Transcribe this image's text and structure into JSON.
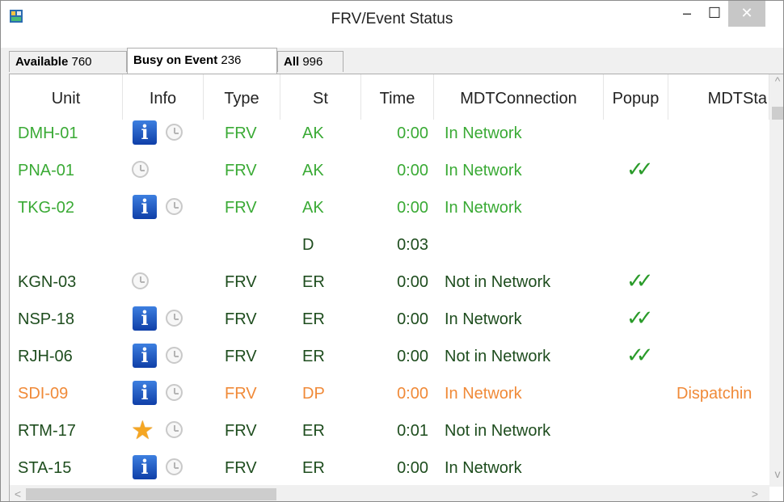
{
  "window": {
    "title": "FRV/Event Status",
    "minimize_glyph": "–",
    "maximize_glyph": "☐",
    "close_glyph": "✕"
  },
  "tabs": [
    {
      "label": "Available",
      "count": "760",
      "active": false
    },
    {
      "label": "Busy on Event",
      "count": "236",
      "active": true
    },
    {
      "label": "All",
      "count": "996",
      "active": false
    }
  ],
  "columns": [
    "Unit",
    "Info",
    "Type",
    "St",
    "Time",
    "MDTConnection",
    "Popup",
    "MDTSta"
  ],
  "rows": [
    {
      "unit": "DMH-01",
      "info_icon": true,
      "clock_icon": true,
      "star_icon": false,
      "type": "FRV",
      "st": "AK",
      "time": "0:00",
      "mdt": "In Network",
      "popup": "",
      "mdtstatus": "",
      "color": "#3aaa35"
    },
    {
      "unit": "PNA-01",
      "info_icon": false,
      "clock_icon": true,
      "star_icon": false,
      "type": "FRV",
      "st": "AK",
      "time": "0:00",
      "mdt": "In Network",
      "popup": "✓✓",
      "mdtstatus": "",
      "color": "#3aaa35"
    },
    {
      "unit": "TKG-02",
      "info_icon": true,
      "clock_icon": true,
      "star_icon": false,
      "type": "FRV",
      "st": "AK",
      "time": "0:00",
      "mdt": "In Network",
      "popup": "",
      "mdtstatus": "",
      "color": "#3aaa35"
    },
    {
      "unit": "",
      "info_icon": false,
      "clock_icon": false,
      "star_icon": false,
      "type": "",
      "st": "D",
      "time": "0:03",
      "mdt": "",
      "popup": "",
      "mdtstatus": "",
      "color": "#1e4d1e"
    },
    {
      "unit": "KGN-03",
      "info_icon": false,
      "clock_icon": true,
      "star_icon": false,
      "type": "FRV",
      "st": "ER",
      "time": "0:00",
      "mdt": "Not in Network",
      "popup": "✓✓",
      "mdtstatus": "",
      "color": "#1e4d1e"
    },
    {
      "unit": "NSP-18",
      "info_icon": true,
      "clock_icon": true,
      "star_icon": false,
      "type": "FRV",
      "st": "ER",
      "time": "0:00",
      "mdt": "In Network",
      "popup": "✓✓",
      "mdtstatus": "",
      "color": "#1e4d1e"
    },
    {
      "unit": "RJH-06",
      "info_icon": true,
      "clock_icon": true,
      "star_icon": false,
      "type": "FRV",
      "st": "ER",
      "time": "0:00",
      "mdt": "Not in Network",
      "popup": "✓✓",
      "mdtstatus": "",
      "color": "#1e4d1e"
    },
    {
      "unit": "SDI-09",
      "info_icon": true,
      "clock_icon": true,
      "star_icon": false,
      "type": "FRV",
      "st": "DP",
      "time": "0:00",
      "mdt": "In Network",
      "popup": "",
      "mdtstatus": "Dispatchin",
      "color": "#f08a38"
    },
    {
      "unit": "RTM-17",
      "info_icon": false,
      "clock_icon": true,
      "star_icon": true,
      "type": "FRV",
      "st": "ER",
      "time": "0:01",
      "mdt": "Not in Network",
      "popup": "",
      "mdtstatus": "",
      "color": "#1e4d1e"
    },
    {
      "unit": "STA-15",
      "info_icon": true,
      "clock_icon": true,
      "star_icon": false,
      "type": "FRV",
      "st": "ER",
      "time": "0:00",
      "mdt": "In Network",
      "popup": "",
      "mdtstatus": "",
      "color": "#1e4d1e"
    }
  ],
  "icons": {
    "info": "i",
    "star": "★",
    "check": "✓✓",
    "scroll_up": "^",
    "scroll_down": "v",
    "scroll_left": "<",
    "scroll_right": ">"
  }
}
